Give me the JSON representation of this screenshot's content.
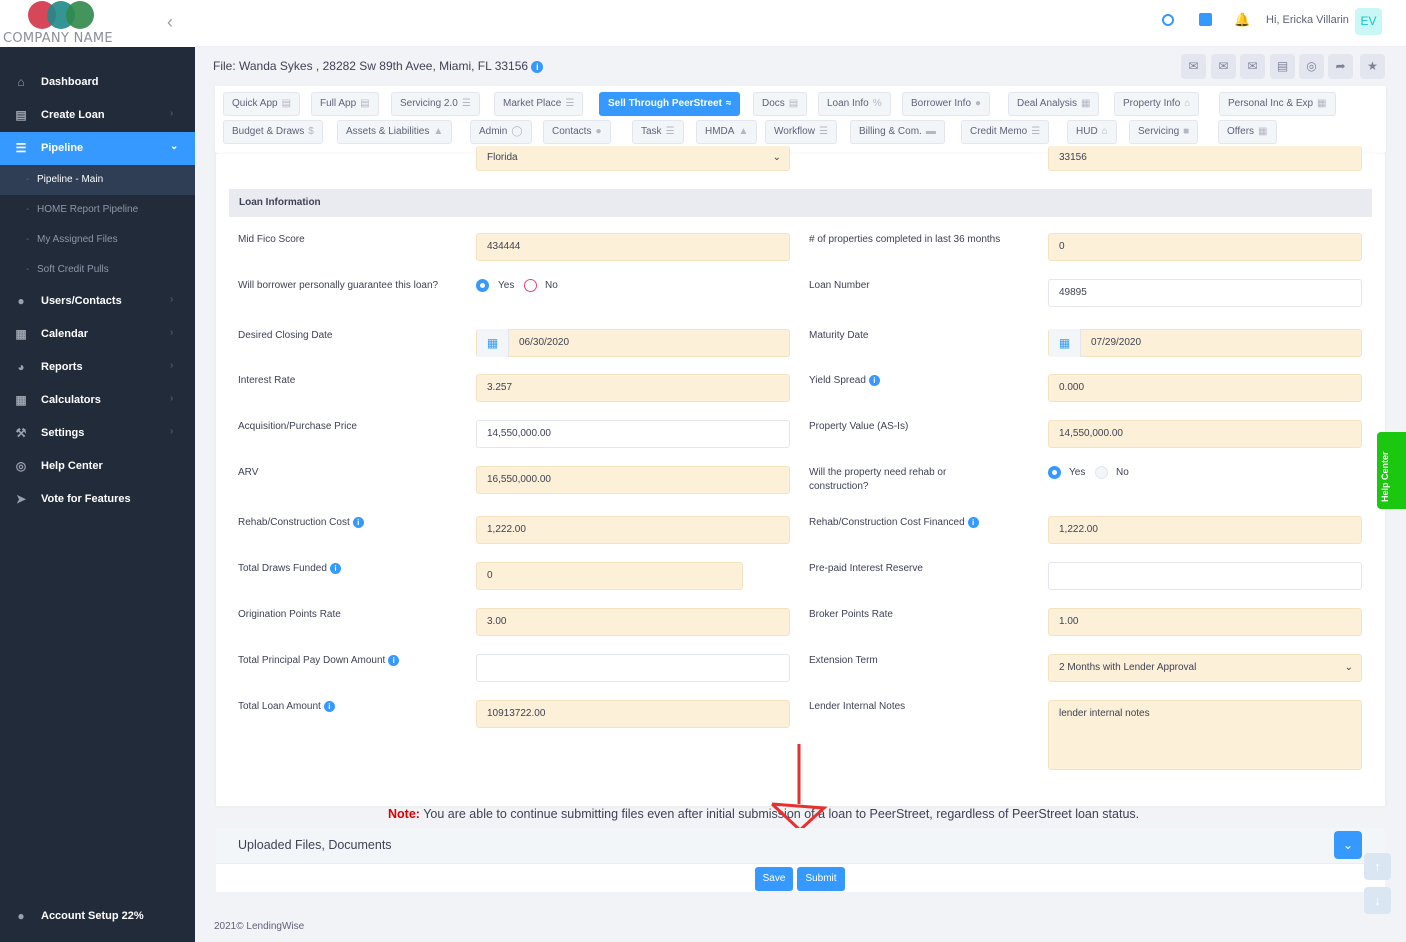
{
  "brand": {
    "company_name": "COMPANY NAME",
    "colors": {
      "red": "#d6475a",
      "teal": "#1f8a8a",
      "green": "#2f8a4a",
      "accent": "#3699ff"
    }
  },
  "header": {
    "greeting": "Hi, Ericka Villarin",
    "avatar_initials": "EV"
  },
  "sidebar": {
    "items": [
      {
        "label": "Dashboard",
        "icon": "home-icon"
      },
      {
        "label": "Create Loan",
        "icon": "document-icon"
      },
      {
        "label": "Pipeline",
        "icon": "list-icon"
      },
      {
        "label": "Users/Contacts",
        "icon": "user-icon"
      },
      {
        "label": "Calendar",
        "icon": "calendar-icon"
      },
      {
        "label": "Reports",
        "icon": "gauge-icon"
      },
      {
        "label": "Calculators",
        "icon": "calculator-icon"
      },
      {
        "label": "Settings",
        "icon": "wrench-icon"
      },
      {
        "label": "Help Center",
        "icon": "lifebuoy-icon"
      },
      {
        "label": "Vote for Features",
        "icon": "rocket-icon"
      }
    ],
    "sub_items": [
      "Pipeline - Main",
      "HOME Report Pipeline",
      "My Assigned Files",
      "Soft Credit Pulls"
    ],
    "account_setup": "Account Setup 22%"
  },
  "file": {
    "title": "File: Wanda Sykes , 28282 Sw 89th Avee, Miami, FL 33156"
  },
  "tabs": {
    "row1": [
      "Quick App",
      "Full App",
      "Servicing 2.0",
      "Market Place",
      "Sell Through PeerStreet",
      "Docs",
      "Loan Info",
      "Borrower Info",
      "Deal Analysis",
      "Property Info",
      "Personal Inc & Exp"
    ],
    "row2": [
      "Budget & Draws",
      "Assets & Liabilities",
      "Admin",
      "Contacts",
      "Task",
      "HMDA",
      "Workflow",
      "Billing & Com.",
      "Credit Memo",
      "HUD",
      "Servicing",
      "Offers"
    ]
  },
  "form": {
    "state_value": "Florida",
    "zip_value": "33156",
    "section_title": "Loan Information",
    "mid_fico_label": "Mid Fico Score",
    "mid_fico_value": "434444",
    "props_completed_label": "# of properties completed in last 36 months",
    "props_completed_value": "0",
    "guarantee_label": "Will borrower personally guarantee this loan?",
    "yes": "Yes",
    "no": "No",
    "loan_number_label": "Loan Number",
    "loan_number_value": "49895",
    "closing_date_label": "Desired Closing Date",
    "closing_date_value": "06/30/2020",
    "maturity_label": "Maturity Date",
    "maturity_value": "07/29/2020",
    "interest_label": "Interest Rate",
    "interest_value": "3.257",
    "yield_label": "Yield Spread",
    "yield_value": "0.000",
    "acq_label": "Acquisition/Purchase Price",
    "acq_value": "14,550,000.00",
    "prop_value_label": "Property Value (AS-Is)",
    "prop_value_value": "14,550,000.00",
    "arv_label": "ARV",
    "arv_value": "16,550,000.00",
    "rehab_need_label": "Will the property need rehab or construction?",
    "rehab_cost_label": "Rehab/Construction Cost",
    "rehab_cost_value": "1,222.00",
    "rehab_fin_label": "Rehab/Construction Cost Financed",
    "rehab_fin_value": "1,222.00",
    "draws_label": "Total Draws Funded",
    "draws_value": "0",
    "prepaid_label": "Pre-paid Interest Reserve",
    "prepaid_value": "",
    "orig_points_label": "Origination Points Rate",
    "orig_points_value": "3.00",
    "broker_points_label": "Broker Points Rate",
    "broker_points_value": "1.00",
    "paydown_label": "Total Principal Pay Down Amount",
    "paydown_value": "",
    "ext_term_label": "Extension Term",
    "ext_term_value": "2 Months with Lender Approval",
    "total_loan_label": "Total Loan Amount",
    "total_loan_value": "10913722.00",
    "notes_label": "Lender Internal Notes",
    "notes_value": "lender internal notes"
  },
  "note": {
    "prefix": "Note:",
    "text": "You are able to continue submitting files even after initial submission of a loan to PeerStreet, regardless of PeerStreet loan status."
  },
  "uploads": {
    "title": "Uploaded Files, Documents"
  },
  "actions": {
    "save": "Save",
    "submit": "Submit"
  },
  "footer": {
    "text": "2021©  LendingWise"
  },
  "help_tab": {
    "label": "Help Center"
  }
}
